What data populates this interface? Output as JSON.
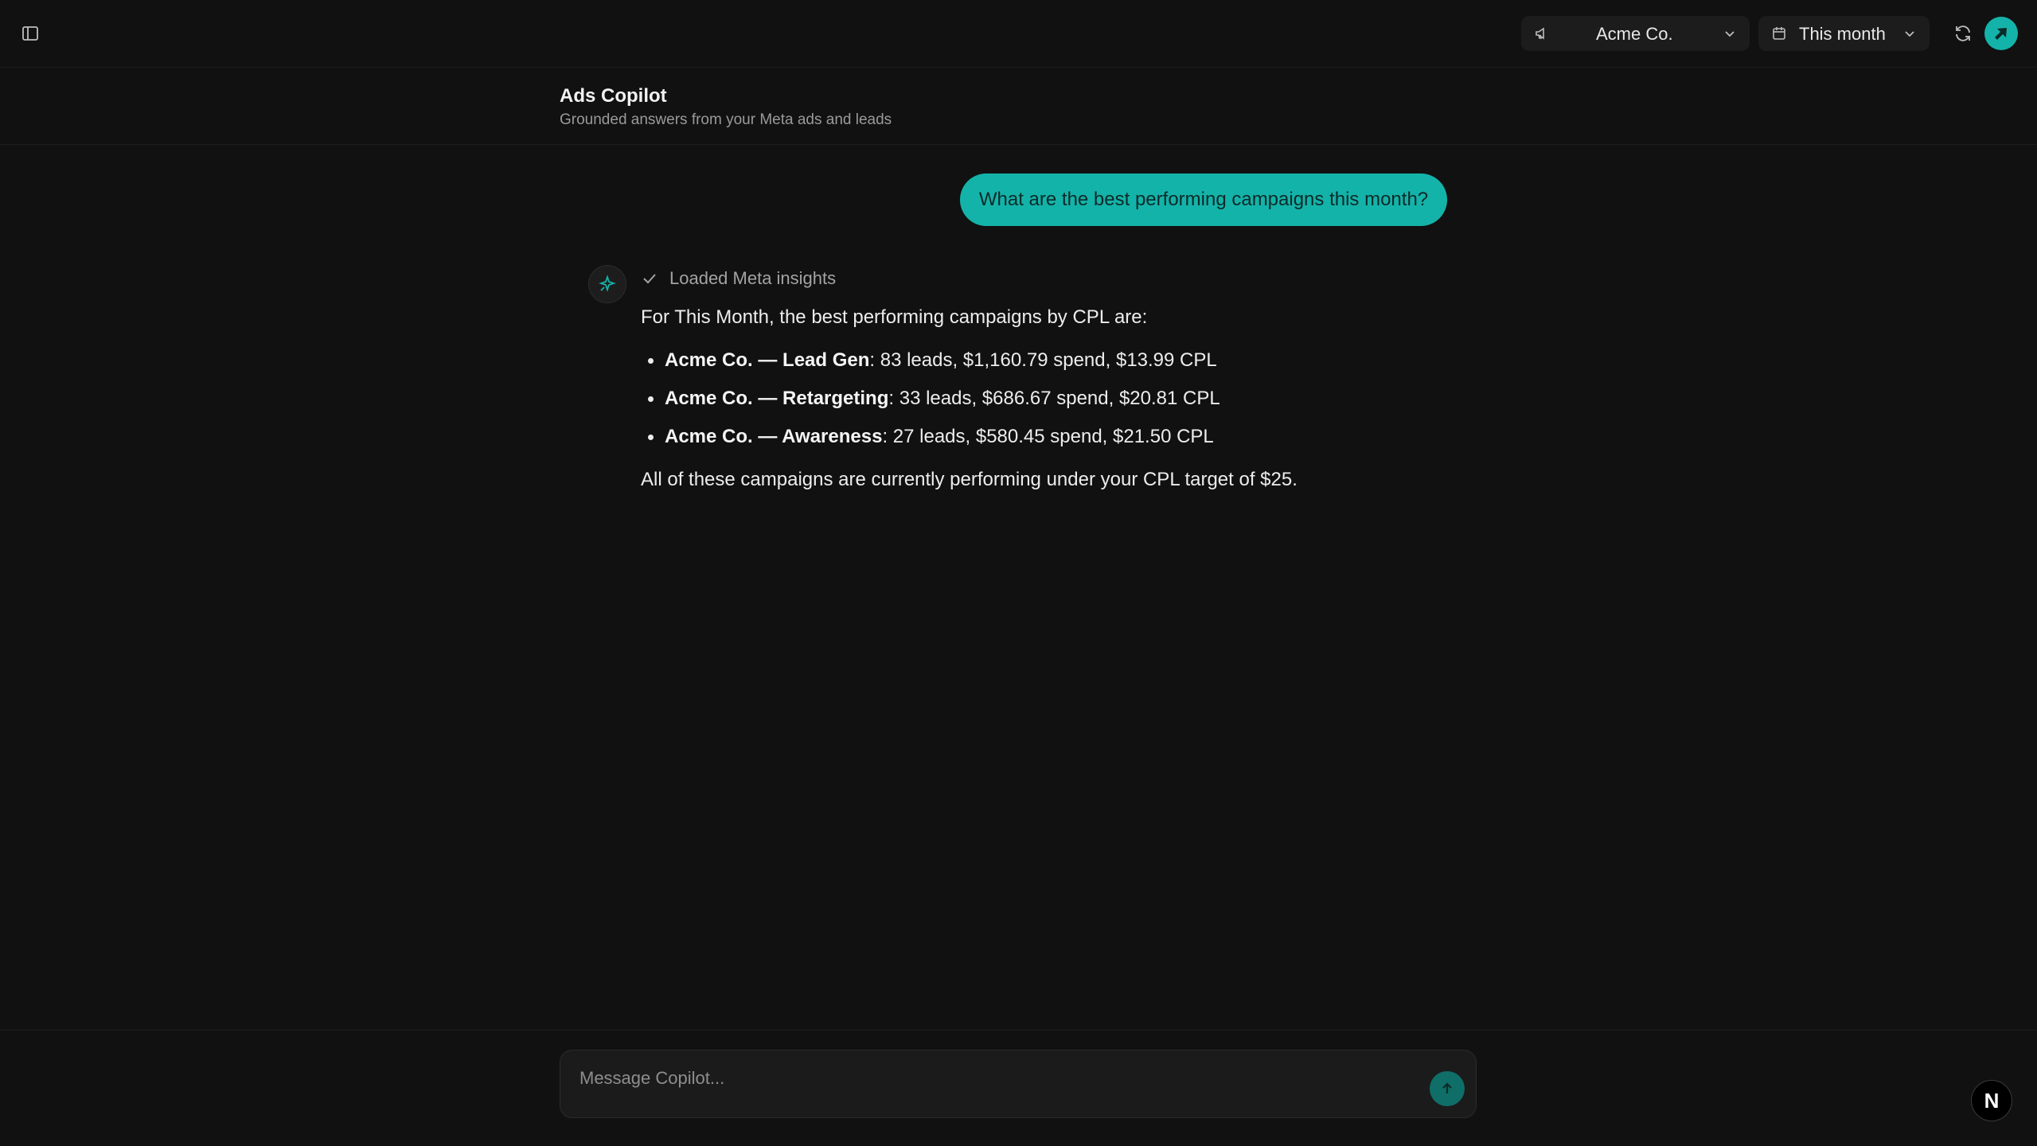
{
  "header": {
    "account_select": {
      "value": "Acme Co.",
      "icon": "megaphone-icon"
    },
    "date_select": {
      "value": "This month",
      "icon": "calendar-icon"
    }
  },
  "page": {
    "title": "Ads Copilot",
    "subtitle": "Grounded answers from your Meta ads and leads"
  },
  "conversation": {
    "user_message": "What are the best performing campaigns this month?",
    "tool_status": "Loaded Meta insights",
    "answer": {
      "intro": "For This Month, the best performing campaigns by CPL are:",
      "items": [
        {
          "name": "Acme Co. — Lead Gen",
          "detail": ": 83 leads, $1,160.79 spend, $13.99 CPL"
        },
        {
          "name": "Acme Co. — Retargeting",
          "detail": ": 33 leads, $686.67 spend, $20.81 CPL"
        },
        {
          "name": "Acme Co. — Awareness",
          "detail": ": 27 leads, $580.45 spend, $21.50 CPL"
        }
      ],
      "outro": "All of these campaigns are currently performing under your CPL target of $25."
    }
  },
  "composer": {
    "placeholder": "Message Copilot..."
  },
  "corner_badge": "N",
  "colors": {
    "accent": "#14b3a9",
    "background": "#111111"
  }
}
